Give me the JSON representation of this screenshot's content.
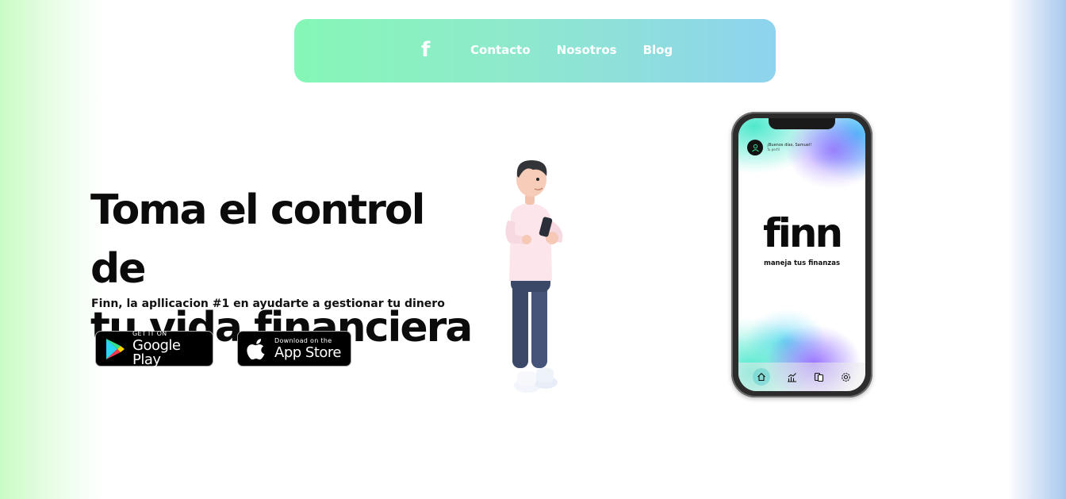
{
  "nav": {
    "logo": "f",
    "links": [
      "Contacto",
      "Nosotros",
      "Blog"
    ]
  },
  "hero": {
    "headline_line1": "Toma el control de",
    "headline_line2": "tu vida financiera",
    "subtitle": "Finn, la apllicacion #1 en ayudarte a gestionar tu dinero"
  },
  "stores": {
    "google_small": "GET IT ON",
    "google_big": "Google Play",
    "apple_small": "Download on the",
    "apple_big": "App Store"
  },
  "phone": {
    "greeting": "¡Buenos días, Samuel!",
    "profile_link": "Tu perfil",
    "brand": "finn",
    "tagline": "maneja tus finanzas",
    "tabs": [
      "home-icon",
      "chart-icon",
      "cards-icon",
      "settings-icon"
    ]
  },
  "colors": {
    "nav_gradient_start": "#86f7b6",
    "nav_gradient_end": "#8ed3ee",
    "text_dark": "#0b0b0b",
    "button_black": "#000000"
  }
}
